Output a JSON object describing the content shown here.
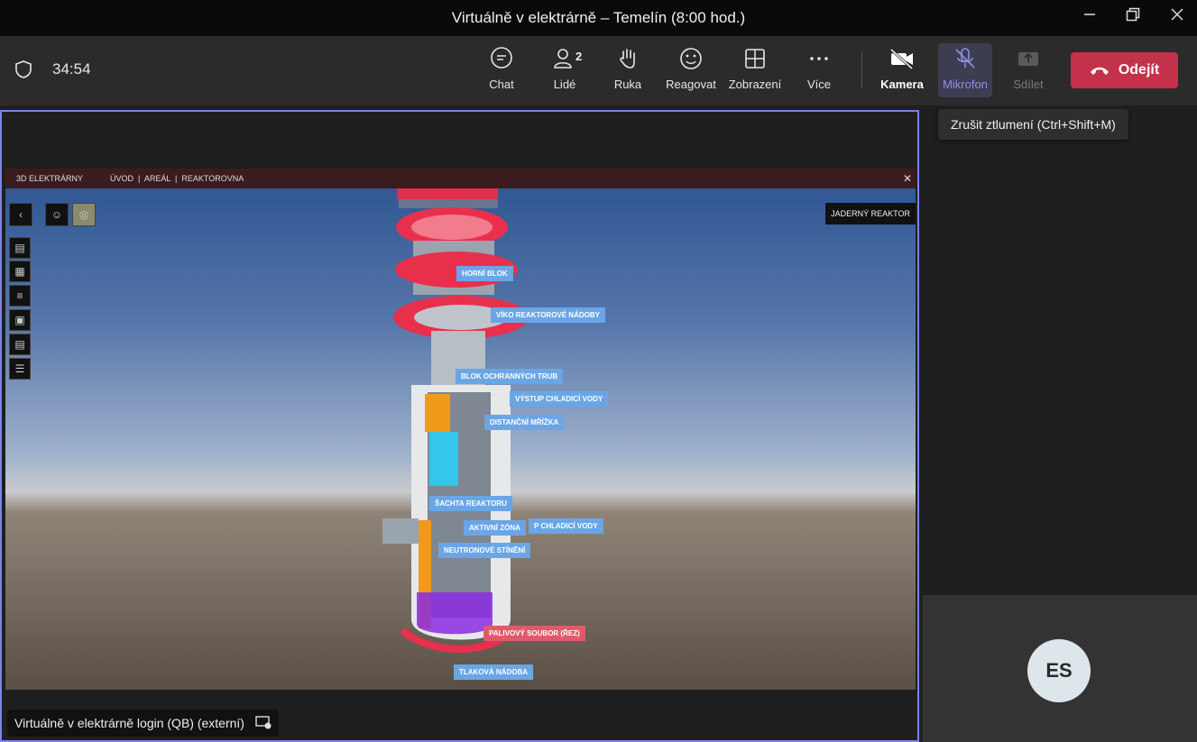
{
  "window": {
    "title": "Virtuálně v elektrárně – Temelín (8:00 hod.)"
  },
  "toolbar": {
    "timer": "34:54",
    "chat_label": "Chat",
    "people_label": "Lidé",
    "people_count": "2",
    "hand_label": "Ruka",
    "react_label": "Reagovat",
    "view_label": "Zobrazení",
    "more_label": "Více",
    "camera_label": "Kamera",
    "mic_label": "Mikrofon",
    "share_label": "Sdílet",
    "leave_label": "Odejít",
    "accent_color": "#7b83eb",
    "leave_color": "#c4314b"
  },
  "tooltip": {
    "text": "Zrušit ztlumení (Ctrl+Shift+M)"
  },
  "shared_screen": {
    "logo_text": "3D ELEKTRÁRNY",
    "breadcrumb": "ÚVOD  |  AREÁL  |  REAKTOROVNA",
    "reactor_title": "JADERNÝ REAKTOR",
    "tags": [
      "HORNÍ BLOK",
      "VÍKO REAKTOROVÉ NÁDOBY",
      "BLOK OCHRANNÝCH TRUB",
      "VÝSTUP CHLADICÍ VODY",
      "DISTANČNÍ MŘÍŽKA",
      "ŠACHTA REAKTORU",
      "AKTIVNÍ ZÓNA",
      "P CHLADICÍ VODY",
      "NEUTRONOVÉ STÍNĚNÍ",
      "PALIVOVÝ SOUBOR (ŘEZ)",
      "TLAKOVÁ NÁDOBA"
    ]
  },
  "caption": {
    "text": "Virtuálně v elektrárně login (QB) (externí)"
  },
  "participant": {
    "initials": "ES"
  }
}
